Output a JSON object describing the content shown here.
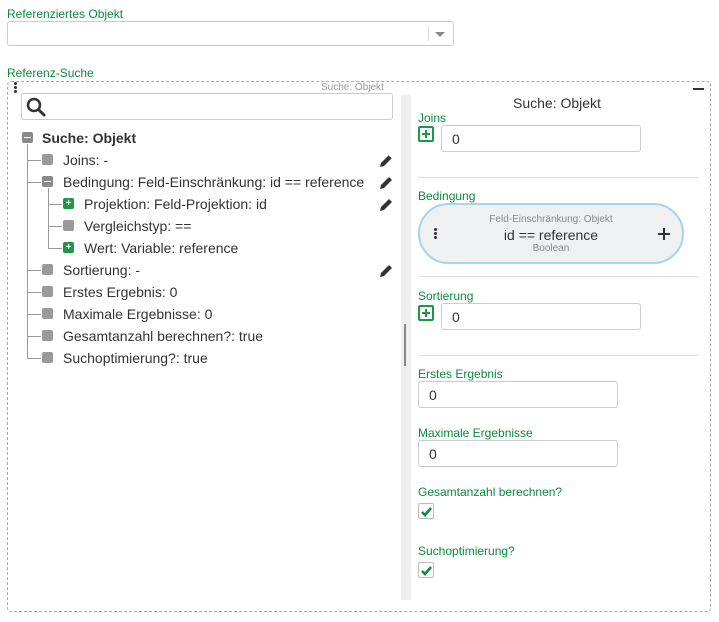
{
  "reference": {
    "label": "Referenziertes Objekt",
    "value": ""
  },
  "search": {
    "label": "Referenz-Suche",
    "small_title": "Suche: Objekt",
    "input_placeholder": ""
  },
  "tree": {
    "root": "Suche: Objekt",
    "items": {
      "joins": "Joins: -",
      "bedingung": "Bedingung: Feld-Einschränkung: id == reference",
      "projektion": "Projektion: Feld-Projektion: id",
      "vergleichstyp": "Vergleichstyp: ==",
      "wert": "Wert: Variable: reference",
      "sortierung": "Sortierung: -",
      "erstes": "Erstes Ergebnis: 0",
      "maximale": "Maximale Ergebnisse: 0",
      "gesamtanzahl": "Gesamtanzahl berechnen?: true",
      "suchoptimierung": "Suchoptimierung?: true"
    }
  },
  "panel": {
    "title": "Suche: Objekt",
    "joins_label": "Joins",
    "joins_value": "0",
    "bedingung_label": "Bedingung",
    "pill_title": "Feld-Einschränkung: Objekt",
    "pill_main": "id == reference",
    "pill_sub": "Boolean",
    "sortierung_label": "Sortierung",
    "sortierung_value": "0",
    "erstes_label": "Erstes Ergebnis",
    "erstes_value": "0",
    "maximale_label": "Maximale Ergebnisse",
    "maximale_value": "0",
    "gesamtanzahl_label": "Gesamtanzahl berechnen?",
    "gesamtanzahl_checked": true,
    "suchoptimierung_label": "Suchoptimierung?",
    "suchoptimierung_checked": true
  },
  "colors": {
    "accent_green": "#0b8a3c",
    "pill_border": "#a9d3e8"
  },
  "icons": [
    "search-icon",
    "pencil-icon",
    "plus-icon",
    "minus-icon",
    "checkmark-icon",
    "chevron-down-icon",
    "dots-icon"
  ]
}
